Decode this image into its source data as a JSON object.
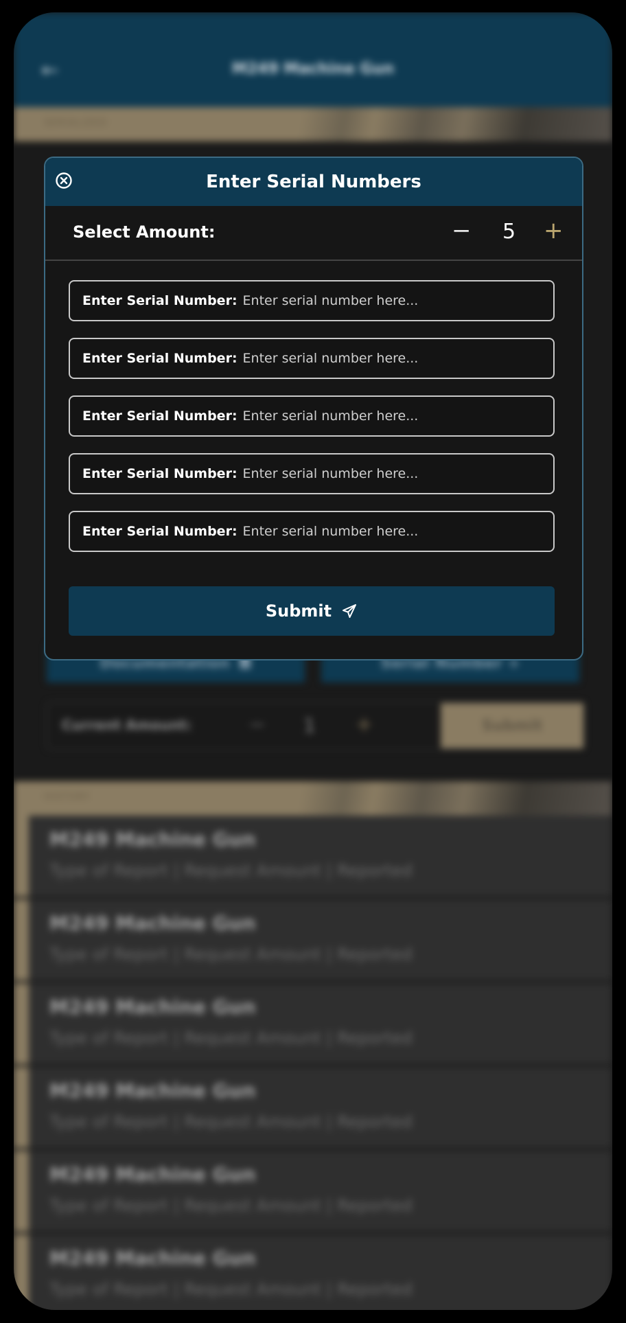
{
  "header": {
    "back_icon": "arrow-left-icon",
    "title": "M249 Machine Gun"
  },
  "sections": {
    "serialized_label": "SERIALIZED",
    "history_label": "HISTORY"
  },
  "actions": {
    "documentation_label": "Documentation",
    "documentation_icon": "document-icon",
    "serial_number_label": "Serial Number +"
  },
  "current_amount": {
    "label": "Current Amount:",
    "minus": "−",
    "value": "1",
    "plus": "+",
    "submit_label": "Submit"
  },
  "history": [
    {
      "title": "M249 Machine Gun",
      "subtitle": "Type of Report | Request Amount | Reported"
    },
    {
      "title": "M249 Machine Gun",
      "subtitle": "Type of Report | Request Amount | Reported"
    },
    {
      "title": "M249 Machine Gun",
      "subtitle": "Type of Report | Request Amount | Reported"
    },
    {
      "title": "M249 Machine Gun",
      "subtitle": "Type of Report | Request Amount | Reported"
    },
    {
      "title": "M249 Machine Gun",
      "subtitle": "Type of Report | Request Amount | Reported"
    },
    {
      "title": "M249 Machine Gun",
      "subtitle": "Type of Report | Request Amount | Reported"
    }
  ],
  "modal": {
    "title": "Enter Serial Numbers",
    "close_icon": "close-circle-icon",
    "select_label": "Select Amount:",
    "stepper_minus": "−",
    "stepper_value": "5",
    "stepper_plus": "+",
    "fields": [
      {
        "label": "Enter Serial Number:",
        "placeholder": "Enter serial number here...",
        "value": ""
      },
      {
        "label": "Enter Serial Number:",
        "placeholder": "Enter serial number here...",
        "value": ""
      },
      {
        "label": "Enter Serial Number:",
        "placeholder": "Enter serial number here...",
        "value": ""
      },
      {
        "label": "Enter Serial Number:",
        "placeholder": "Enter serial number here...",
        "value": ""
      },
      {
        "label": "Enter Serial Number:",
        "placeholder": "Enter serial number here...",
        "value": ""
      }
    ],
    "submit_label": "Submit",
    "submit_icon": "send-icon"
  },
  "colors": {
    "primary": "#0e3a52",
    "accent_tan": "#8a7c62",
    "background": "#1a1a1a"
  }
}
